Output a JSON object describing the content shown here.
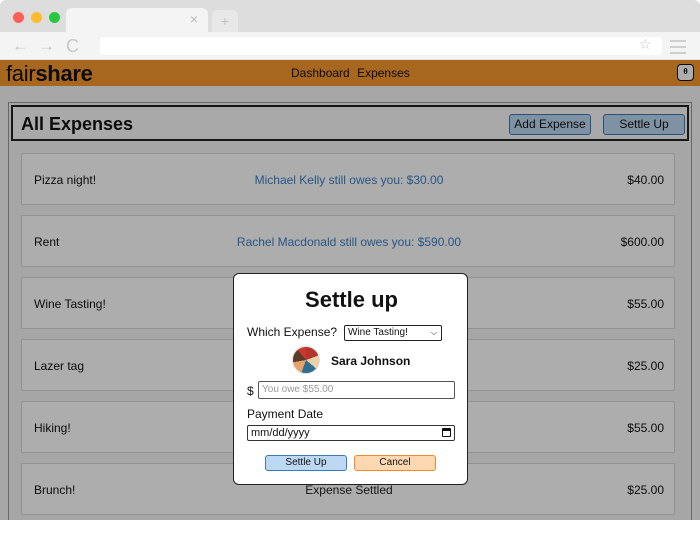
{
  "browser": {
    "tab_close_glyph": "×",
    "new_tab_glyph": "+",
    "back_glyph": "←",
    "forward_glyph": "→",
    "reload_glyph": "C",
    "bookmark_glyph": "☆"
  },
  "app": {
    "logo_light": "fair",
    "logo_bold": "share",
    "nav": {
      "dashboard": "Dashboard",
      "expenses": "Expenses"
    },
    "user_button_glyph": "θ"
  },
  "page": {
    "title": "All Expenses",
    "add_expense_label": "Add Expense",
    "settle_up_label": "Settle Up"
  },
  "expenses": [
    {
      "name": "Pizza night!",
      "status": "Michael Kelly still owes you: $30.00",
      "amount": "$40.00"
    },
    {
      "name": "Rent",
      "status": "Rachel Macdonald still owes you: $590.00",
      "amount": "$600.00"
    },
    {
      "name": "Wine Tasting!",
      "status": "",
      "amount": "$55.00"
    },
    {
      "name": "Lazer tag",
      "status": "",
      "amount": "$25.00"
    },
    {
      "name": "Hiking!",
      "status": "",
      "amount": "$55.00"
    },
    {
      "name": "Brunch!",
      "status": "Expense Settled",
      "amount": "$25.00"
    }
  ],
  "modal": {
    "title": "Settle up",
    "which_expense_label": "Which Expense?",
    "selected_expense": "Wine Tasting!",
    "user_name": "Sara Johnson",
    "dollar_sign": "$",
    "amount_placeholder": "You owe $55.00",
    "payment_date_label": "Payment Date",
    "date_placeholder": "mm/dd/yyyy",
    "settle_button": "Settle Up",
    "cancel_button": "Cancel"
  },
  "colors": {
    "accent_orange": "#f7982e",
    "button_blue": "#bcd8f2",
    "link_blue": "#3b7fc4",
    "cancel_orange": "#fbd8b2"
  }
}
